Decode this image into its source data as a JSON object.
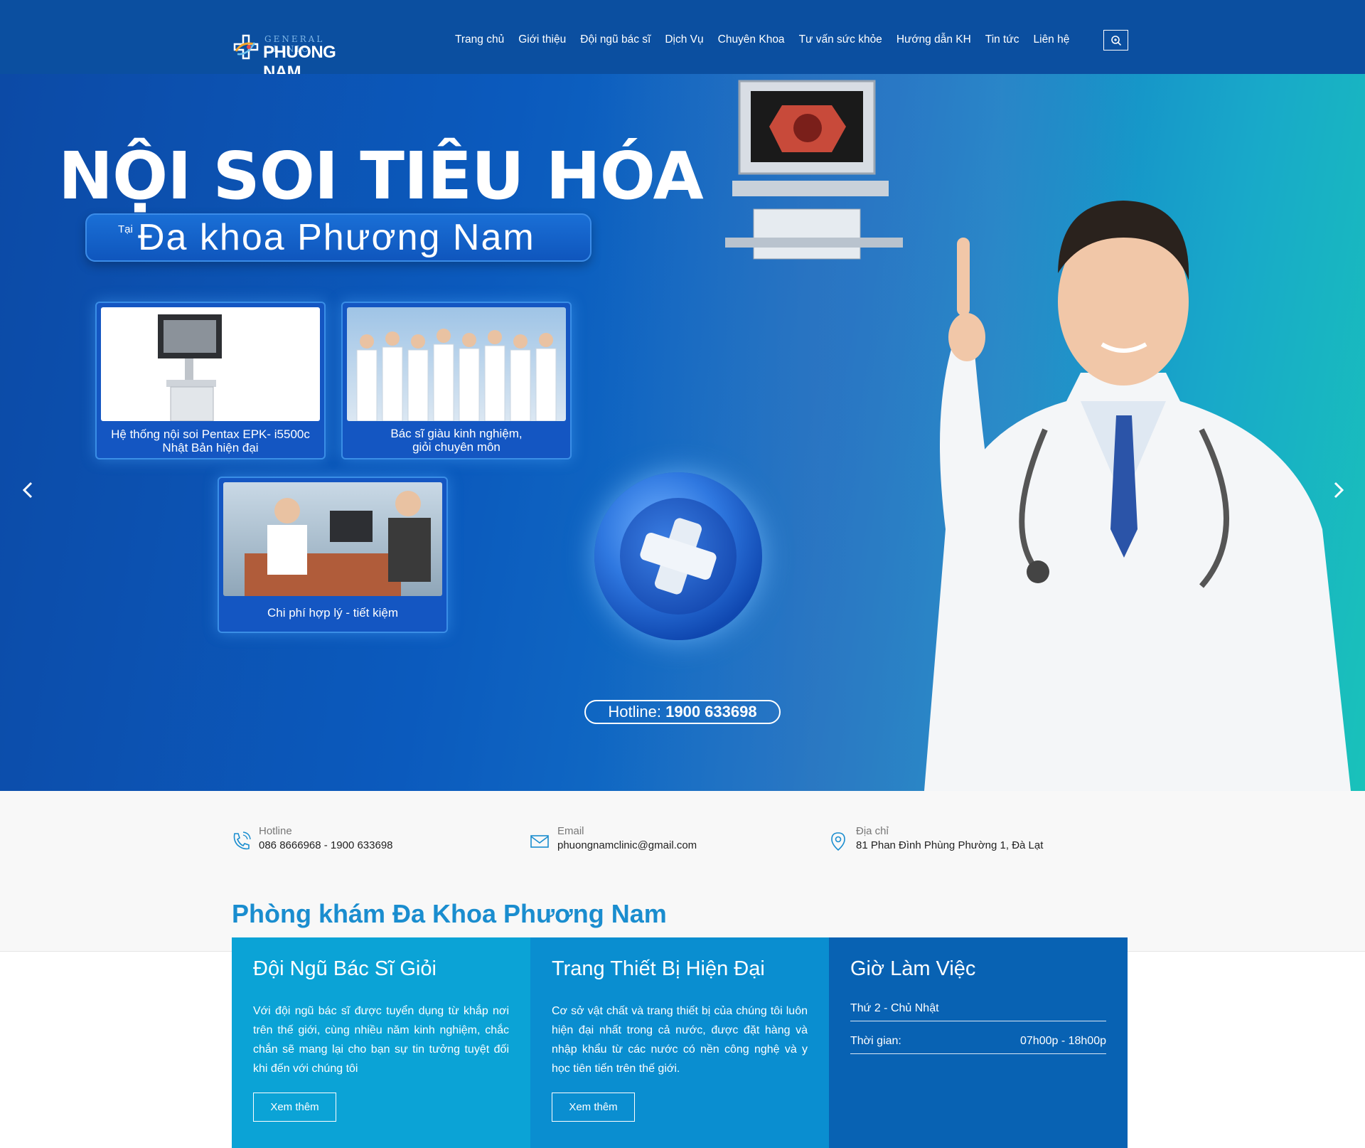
{
  "header": {
    "logo_small": "GENERAL CLINIC",
    "logo_big": "PHUONG NAM",
    "nav": [
      "Trang chủ",
      "Giới thiệu",
      "Đội ngũ bác sĩ",
      "Dịch Vụ",
      "Chuyên Khoa",
      "Tư vấn sức khỏe",
      "Hướng dẫn KH",
      "Tin tức",
      "Liên hệ"
    ],
    "search_icon": "search-icon"
  },
  "hero": {
    "title": "NỘI SOI TIÊU HÓA",
    "pill_prefix": "Tại",
    "pill_text": "Đa khoa Phương Nam",
    "cards": [
      {
        "caption_line1": "Hệ thống nội soi Pentax EPK- i5500c",
        "caption_line2": "Nhật Bản hiện đại"
      },
      {
        "caption_line1": "Bác sĩ giàu kinh nghiệm,",
        "caption_line2": "giỏi chuyên môn"
      },
      {
        "caption_line1": "Chi phí hợp lý - tiết kiệm",
        "caption_line2": ""
      }
    ],
    "hotline_label": "Hotline:",
    "hotline_number": "1900 633698",
    "prev_icon": "chevron-left-icon",
    "next_icon": "chevron-right-icon"
  },
  "contact": {
    "hotline": {
      "label": "Hotline",
      "value": "086 8666968 - 1900 633698",
      "icon": "phone-icon"
    },
    "email": {
      "label": "Email",
      "value": "phuongnamclinic@gmail.com",
      "icon": "mail-icon"
    },
    "address": {
      "label": "Địa chỉ",
      "value": "81 Phan Đình Phùng Phường 1, Đà Lạt",
      "icon": "map-pin-icon"
    }
  },
  "clinic_title": "Phòng khám Đa Khoa Phương Nam",
  "features": [
    {
      "title": "Đội Ngũ Bác Sĩ Giỏi",
      "desc": "Với đội ngũ bác sĩ được tuyển dụng từ khắp nơi trên thế giới, cùng nhiều năm kinh nghiệm, chắc chắn sẽ mang lại cho bạn sự tin tưởng tuyệt đối khi đến với chúng tôi",
      "button": "Xem thêm"
    },
    {
      "title": "Trang Thiết Bị Hiện Đại",
      "desc": "Cơ sở vật chất và trang thiết bị của chúng tôi luôn hiện đại nhất trong cả nước, được đặt hàng và nhập khẩu từ các nước có nền công nghệ và y học tiên tiến trên thế giới.",
      "button": "Xem thêm"
    },
    {
      "title": "Giờ Làm Việc",
      "row1_label": "Thứ 2 - Chủ Nhật",
      "row2_label": "Thời gian:",
      "row2_value": "07h00p - 18h00p"
    }
  ],
  "colors": {
    "header_bg": "#0b4fa0",
    "accent": "#1a8dcf",
    "feature1": "#0ba3d6",
    "feature2": "#0a8ed0",
    "feature3": "#0862b3"
  }
}
